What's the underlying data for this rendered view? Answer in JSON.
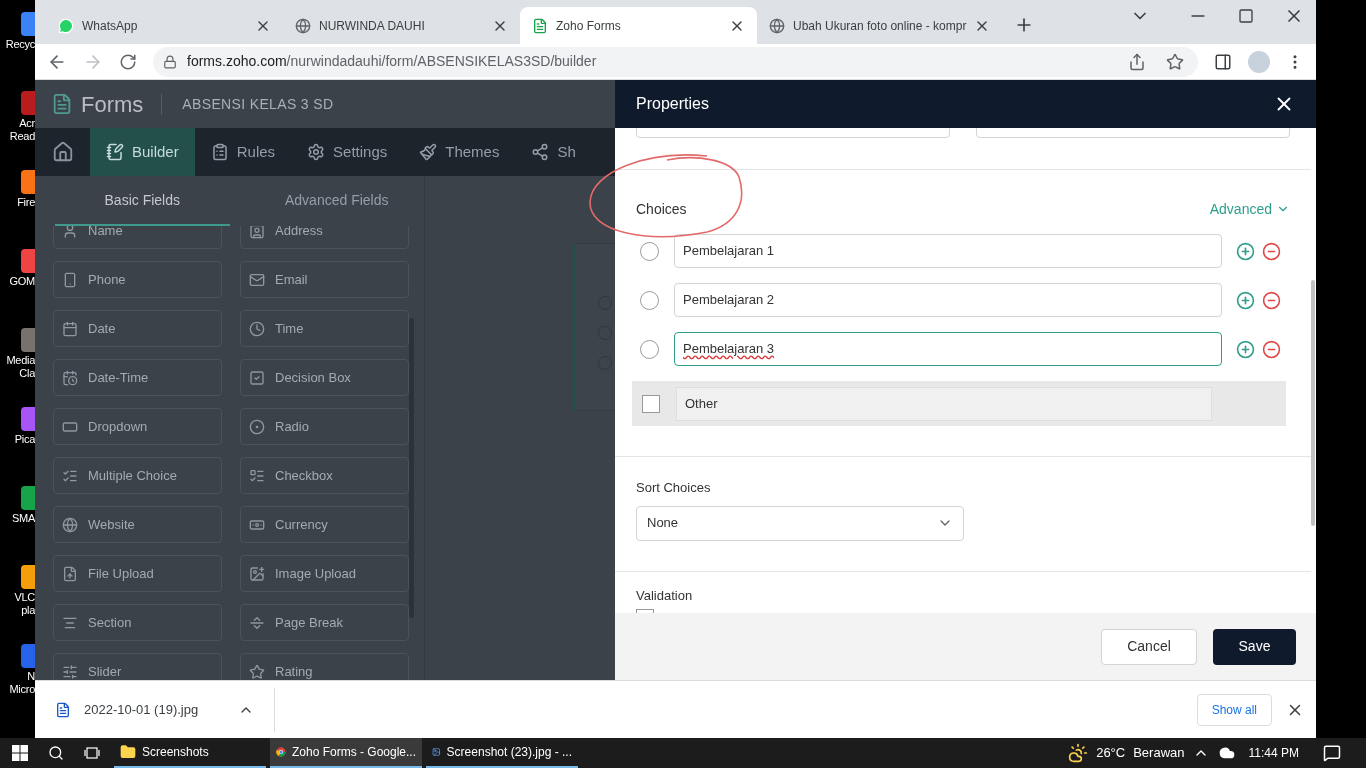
{
  "desktop_icons": [
    {
      "label": "Recyc",
      "color": "#3b82f6"
    },
    {
      "label": "Acr\nRead",
      "color": "#b91c1c"
    },
    {
      "label": "Fire",
      "color": "#f97316"
    },
    {
      "label": "GOM",
      "color": "#ef4444"
    },
    {
      "label": "Media\nCla",
      "color": "#78716c"
    },
    {
      "label": "Pica",
      "color": "#a855f7"
    },
    {
      "label": "SMA",
      "color": "#16a34a"
    },
    {
      "label": "VLC\npla",
      "color": "#f59e0b"
    },
    {
      "label": "N\nMicro",
      "color": "#2563eb"
    }
  ],
  "browser": {
    "tabs": [
      {
        "title": "WhatsApp",
        "kind": "whatsapp",
        "selected": false
      },
      {
        "title": "NURWINDA DAUHI",
        "kind": "globe",
        "selected": false
      },
      {
        "title": "Zoho Forms",
        "kind": "forms",
        "selected": true
      },
      {
        "title": "Ubah Ukuran foto online - kompr",
        "kind": "globe",
        "selected": false
      }
    ],
    "url_host": "forms.zoho.com",
    "url_path": "/nurwindadauhi/form/ABSENSIKELAS3SD/builder"
  },
  "app": {
    "logo": "Forms",
    "form_name": "ABSENSI KELAS 3 SD",
    "nav": [
      {
        "label": "Builder",
        "kind": "builder",
        "selected": true
      },
      {
        "label": "Rules",
        "kind": "rules",
        "selected": false
      },
      {
        "label": "Settings",
        "kind": "settings",
        "selected": false
      },
      {
        "label": "Themes",
        "kind": "themes",
        "selected": false
      },
      {
        "label": "Sh",
        "kind": "share",
        "selected": false
      }
    ],
    "field_tabs": [
      {
        "label": "Basic Fields",
        "selected": true
      },
      {
        "label": "Advanced Fields",
        "selected": false
      }
    ],
    "fields": [
      {
        "label": "Name",
        "kind": "name"
      },
      {
        "label": "Address",
        "kind": "address"
      },
      {
        "label": "Phone",
        "kind": "phone"
      },
      {
        "label": "Email",
        "kind": "email"
      },
      {
        "label": "Date",
        "kind": "date"
      },
      {
        "label": "Time",
        "kind": "time"
      },
      {
        "label": "Date-Time",
        "kind": "datetime"
      },
      {
        "label": "Decision Box",
        "kind": "decision"
      },
      {
        "label": "Dropdown",
        "kind": "dropdown"
      },
      {
        "label": "Radio",
        "kind": "radio"
      },
      {
        "label": "Multiple Choice",
        "kind": "multiple"
      },
      {
        "label": "Checkbox",
        "kind": "checkbox"
      },
      {
        "label": "Website",
        "kind": "website"
      },
      {
        "label": "Currency",
        "kind": "currency"
      },
      {
        "label": "File Upload",
        "kind": "file"
      },
      {
        "label": "Image Upload",
        "kind": "image"
      },
      {
        "label": "Section",
        "kind": "section"
      },
      {
        "label": "Page Break",
        "kind": "pagebreak"
      },
      {
        "label": "Slider",
        "kind": "slider"
      },
      {
        "label": "Rating",
        "kind": "rating"
      }
    ]
  },
  "properties": {
    "title": "Properties",
    "choices_label": "Choices",
    "advanced": "Advanced",
    "choices": [
      {
        "label": "Pembelajaran 1",
        "focused": false
      },
      {
        "label": "Pembelajaran 2",
        "focused": false
      },
      {
        "label": "Pembelajaran 3",
        "focused": true
      }
    ],
    "other": {
      "label": "Other",
      "checked": false
    },
    "sort_label": "Sort Choices",
    "sort_value": "None",
    "validation_label": "Validation",
    "validation_checked": false,
    "cancel": "Cancel",
    "save": "Save"
  },
  "downloads": {
    "file": "2022-10-01 (19).jpg",
    "show_all": "Show all"
  },
  "taskbar": {
    "apps": [
      {
        "label": "Screenshots",
        "kind": "folder",
        "selected": false
      },
      {
        "label": "Zoho Forms - Google...",
        "kind": "chrome",
        "selected": true
      },
      {
        "label": "Screenshot (23).jpg - ...",
        "kind": "photos",
        "selected": false
      }
    ],
    "temperature": "26°C",
    "weather": "Berawan",
    "time": "11:44 PM"
  }
}
